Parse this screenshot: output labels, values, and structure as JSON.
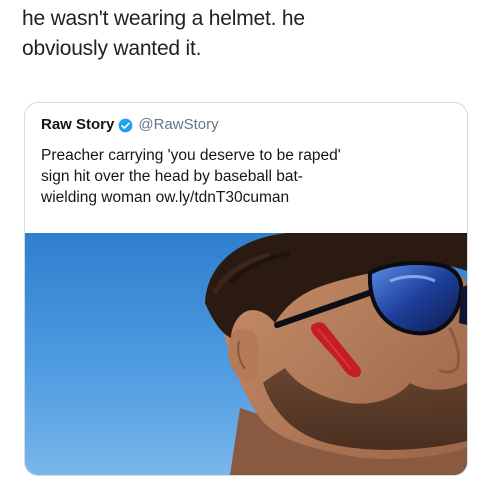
{
  "caption": {
    "line1": "he wasn't wearing a helmet. he",
    "line2": "obviously wanted it."
  },
  "tweet": {
    "author_name": "Raw Story",
    "verified_icon": "verified-badge-icon",
    "handle": "@RawStory",
    "text_line1": "Preacher carrying 'you deserve to be raped'",
    "text_line2": "sign hit over the head by baseball bat-",
    "text_line3": "wielding woman ow.ly/tdnT30cuman",
    "photo_icon": "man-with-sunglasses-photo",
    "colors": {
      "verified_blue": "#1da1f2",
      "sky_blue": "#3f8fd6",
      "handle_gray": "#657786"
    }
  }
}
